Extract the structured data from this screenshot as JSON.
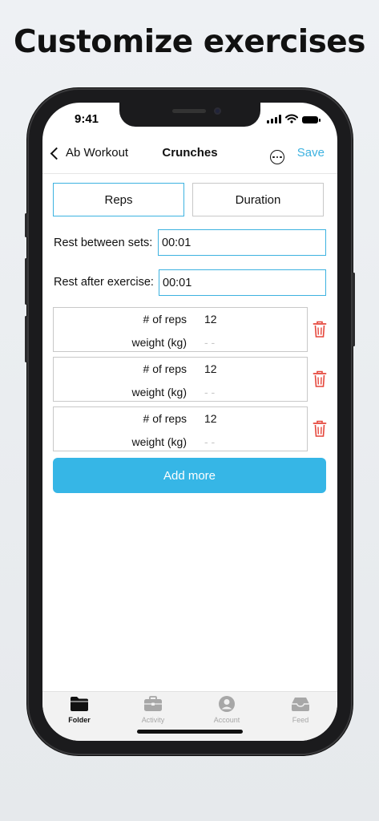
{
  "headline": "Customize exercises",
  "status_bar": {
    "time": "9:41"
  },
  "nav": {
    "back_label": "Ab Workout",
    "title": "Crunches",
    "save_label": "Save"
  },
  "segments": {
    "reps": "Reps",
    "duration": "Duration",
    "selected": "Reps"
  },
  "rest": {
    "between_sets_label": "Rest between sets:",
    "between_sets_value": "00:01",
    "after_exercise_label": "Rest after exercise:",
    "after_exercise_value": "00:01"
  },
  "sets": [
    {
      "reps_label": "# of reps",
      "reps_value": "12",
      "weight_label": "weight (kg)",
      "weight_placeholder": "- -"
    },
    {
      "reps_label": "# of reps",
      "reps_value": "12",
      "weight_label": "weight (kg)",
      "weight_placeholder": "- -"
    },
    {
      "reps_label": "# of reps",
      "reps_value": "12",
      "weight_label": "weight (kg)",
      "weight_placeholder": "- -"
    }
  ],
  "add_more_label": "Add more",
  "tabs": [
    {
      "label": "Folder",
      "icon": "folder-icon",
      "active": true
    },
    {
      "label": "Activity",
      "icon": "briefcase-icon",
      "active": false
    },
    {
      "label": "Account",
      "icon": "account-icon",
      "active": false
    },
    {
      "label": "Feed",
      "icon": "inbox-icon",
      "active": false
    }
  ],
  "colors": {
    "accent": "#3db2e0",
    "button": "#36b6e6",
    "delete": "#e5453a",
    "tab_inactive": "#a7a7a7",
    "tab_active": "#111111"
  }
}
